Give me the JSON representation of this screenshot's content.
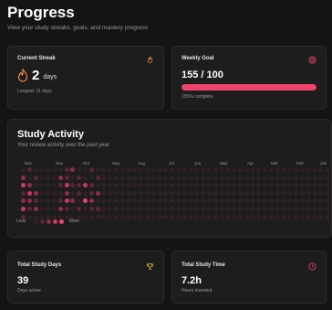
{
  "header": {
    "title": "Progress",
    "subtitle": "View your study streaks, goals, and mastery progress"
  },
  "streak": {
    "title": "Current Streak",
    "icon": "flame-icon",
    "value": "2",
    "unit": "days",
    "longest": "Longest: 11 days"
  },
  "goal": {
    "title": "Weekly Goal",
    "icon": "target-icon",
    "value": "155 / 100",
    "progress_fraction": 1.0,
    "percent_text": "155% complete"
  },
  "activity": {
    "title": "Study Activity",
    "subtitle": "Your review activity over the past year",
    "months": [
      "Dec",
      "Nov",
      "Oct",
      "Sep",
      "Aug",
      "Jul",
      "Jun",
      "May",
      "Apr",
      "Mar",
      "Feb",
      "Jan"
    ],
    "legend_less": "Less",
    "legend_more": "More"
  },
  "total_days": {
    "title": "Total Study Days",
    "icon": "trophy-icon",
    "value": "39",
    "sub": "Days active"
  },
  "total_time": {
    "title": "Total Study Time",
    "icon": "clock-icon",
    "value": "7.2h",
    "sub": "Hours invested"
  },
  "colors": {
    "accent": "#f0436e",
    "level0": "#2f2125",
    "level1": "#5a2635",
    "level2": "#8f2f4a",
    "level3": "#c93b62",
    "level4": "#f0436e"
  }
}
